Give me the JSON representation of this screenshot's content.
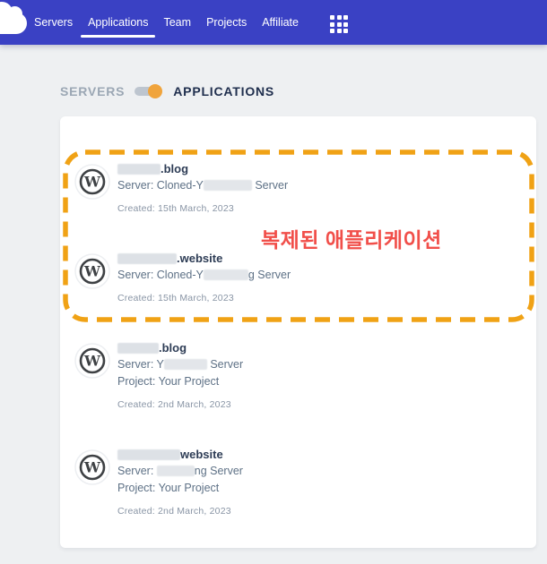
{
  "header": {
    "nav_items": [
      {
        "label": "Servers",
        "active": false
      },
      {
        "label": "Applications",
        "active": true
      },
      {
        "label": "Team",
        "active": false
      },
      {
        "label": "Projects",
        "active": false
      },
      {
        "label": "Affiliate",
        "active": false
      }
    ],
    "logo_icon": "cloud-logo",
    "apps_menu_icon": "grid-apps-icon"
  },
  "view_toggle": {
    "servers_label": "SERVERS",
    "applications_label": "APPLICATIONS",
    "state": "applications"
  },
  "annotation": {
    "text": "복제된 애플리케이션",
    "text_color": "#f14f4a",
    "box_color": "#f0a215"
  },
  "applications": [
    {
      "name_mask_w": 48,
      "name_visible": ".blog",
      "server_before": "Server: Cloned-Y",
      "server_mask_w": 54,
      "server_after": " Server",
      "project": "",
      "created": "Created: 15th March, 2023",
      "highlighted": true
    },
    {
      "name_mask_w": 66,
      "name_visible": ".website",
      "server_before": "Server: Cloned-Y",
      "server_mask_w": 50,
      "server_after": "g Server",
      "project": "",
      "created": "Created: 15th March, 2023",
      "highlighted": true
    },
    {
      "name_mask_w": 46,
      "name_visible": ".blog",
      "server_before": "Server: Y",
      "server_mask_w": 48,
      "server_after": " Server",
      "project": "Project: Your Project",
      "created": "Created: 2nd March, 2023",
      "highlighted": false
    },
    {
      "name_mask_w": 70,
      "name_visible": "website",
      "server_before": "Server: ",
      "server_mask_w": 42,
      "server_after": "ng Server",
      "project": "Project: Your Project",
      "created": "Created: 2nd March, 2023",
      "highlighted": false
    }
  ],
  "colors": {
    "navbar_bg": "#3a41c4",
    "page_bg": "#eef0f2",
    "toggle_knob": "#f0a43c",
    "dash_orange": "#f0a215",
    "annotation_red": "#f14f4a"
  }
}
